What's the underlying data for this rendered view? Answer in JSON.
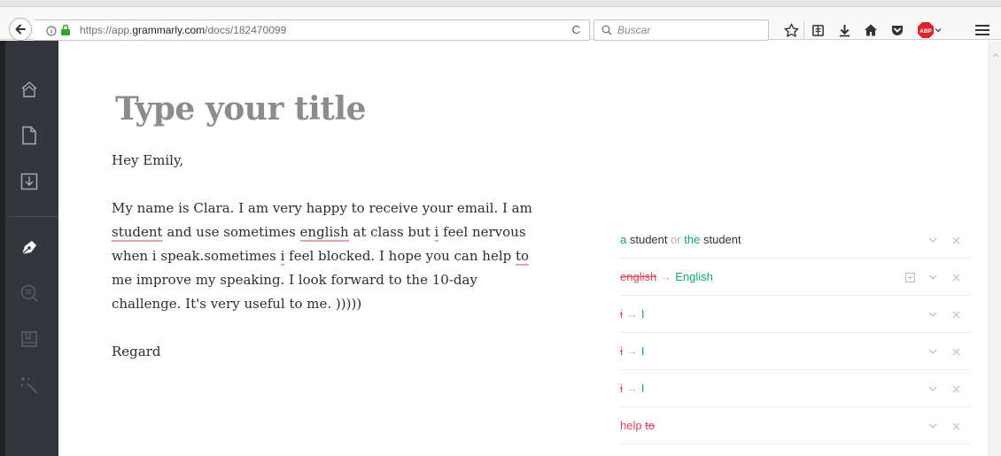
{
  "browser": {
    "url_prefix": "https://app.",
    "url_host": "grammarly.com",
    "url_path": "/docs/182470099",
    "search_placeholder": "Buscar",
    "reload_glyph": "C",
    "abp_label": "ABP"
  },
  "sidebar": {
    "items": [
      "home-icon",
      "new-document-icon",
      "download-icon",
      "pen-icon",
      "inspect-icon",
      "book-icon",
      "magic-wand-icon"
    ]
  },
  "editor": {
    "title_placeholder": "Type your title",
    "greeting": "Hey Emily,",
    "body": {
      "l1": "My name is Clara. I am very happy to receive your email. I am",
      "l2_w1": "student",
      "l2_t1": " and use sometimes ",
      "l2_w2": "english",
      "l2_t2": " at class but ",
      "l2_w3": "i",
      "l2_t3": " feel nervous",
      "l3_t1": "when i speak.sometimes ",
      "l3_w1": "i",
      "l3_t2": " feel blocked. I hope you can help ",
      "l3_w2": "to",
      "l4": "me improve my speaking. I look forward to the 10-day",
      "l5": "challenge. It's very useful to me. )))))"
    },
    "closing": "Regard"
  },
  "suggestions": [
    {
      "a": "a",
      "b": " student",
      "or": " or ",
      "c": "the",
      "d": " student"
    },
    {
      "wrong": "english",
      "right": "English"
    },
    {
      "wrong": "i",
      "right": "I"
    },
    {
      "wrong": "i",
      "right": "I"
    },
    {
      "wrong": "i",
      "right": "I"
    },
    {
      "keep": "help ",
      "wrong": "to"
    }
  ],
  "colors": {
    "accent_green": "#15a576",
    "error_red": "#e0445a",
    "sidebar_bg": "#33373b"
  }
}
